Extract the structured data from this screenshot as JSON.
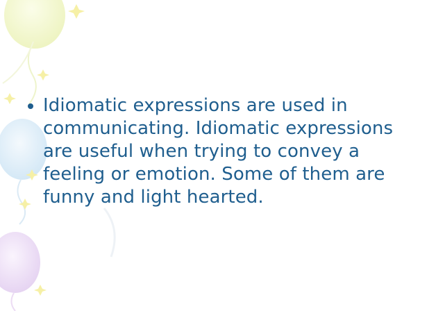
{
  "slide": {
    "bullets": [
      {
        "text": "Idiomatic expressions are used in communicating. Idiomatic expressions are useful when trying to convey a feeling or emotion. Some of them are funny and light hearted."
      }
    ]
  },
  "decorations": {
    "icons": [
      "balloon-icon",
      "sparkle-icon"
    ],
    "colors": {
      "text": "#1f5e8e",
      "balloon_yellow": "#f0f5c8",
      "balloon_blue": "#d7eaf7",
      "balloon_purple": "#ead9f4",
      "sparkle": "#f6f0a6"
    }
  }
}
